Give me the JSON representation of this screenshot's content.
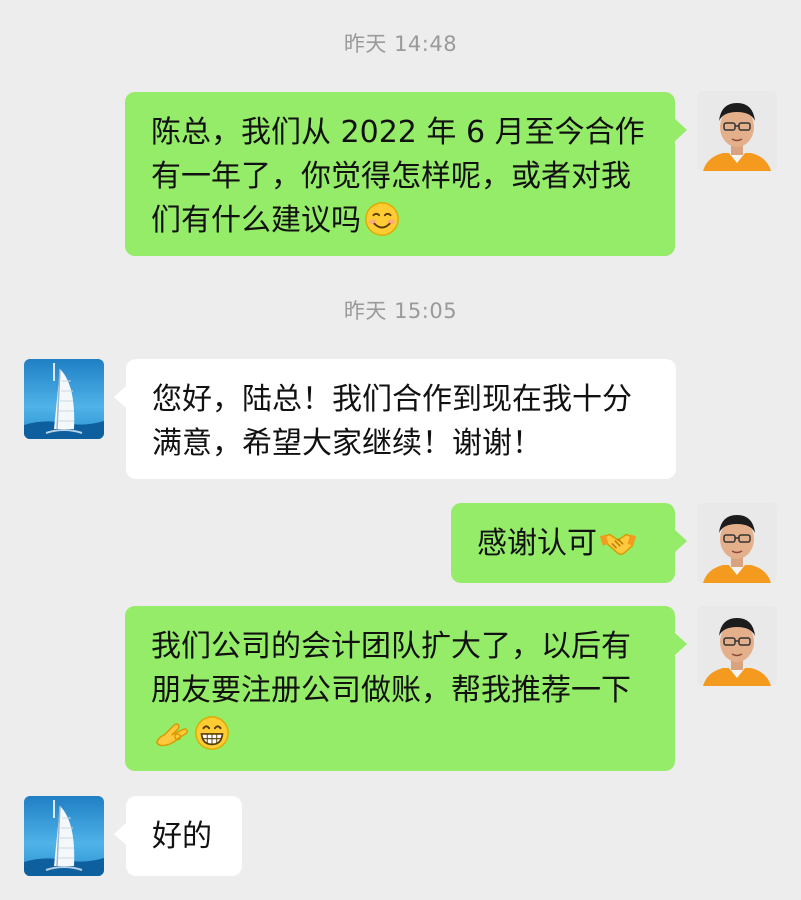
{
  "conversation": {
    "messages": [
      {
        "type": "time",
        "text": "昨天 14:48"
      },
      {
        "type": "bubble",
        "side": "out",
        "text": "陈总，我们从 2022 年 6 月至今合作有一年了，你觉得怎样呢，或者对我们有什么建议吗",
        "emoji": "smiling-face-icon"
      },
      {
        "type": "time",
        "text": "昨天 15:05"
      },
      {
        "type": "bubble",
        "side": "in",
        "text": "您好，陆总！我们合作到现在我十分满意，希望大家继续！谢谢！"
      },
      {
        "type": "bubble",
        "side": "out",
        "text": "感谢认可",
        "emoji": "handshake-icon"
      },
      {
        "type": "bubble",
        "side": "out",
        "text": "我们公司的会计团队扩大了，以后有朋友要注册公司做账，帮我推荐一下",
        "emoji": "ok-hand-icon,grinning-face-icon"
      },
      {
        "type": "bubble",
        "side": "in",
        "text": "好的"
      }
    ]
  },
  "colors": {
    "background": "#ededed",
    "outgoing_bubble": "#95ec69",
    "incoming_bubble": "#ffffff",
    "timestamp_text": "#9a9a9a"
  },
  "avatars": {
    "self": "person-avatar",
    "contact": "burj-al-arab-avatar"
  }
}
